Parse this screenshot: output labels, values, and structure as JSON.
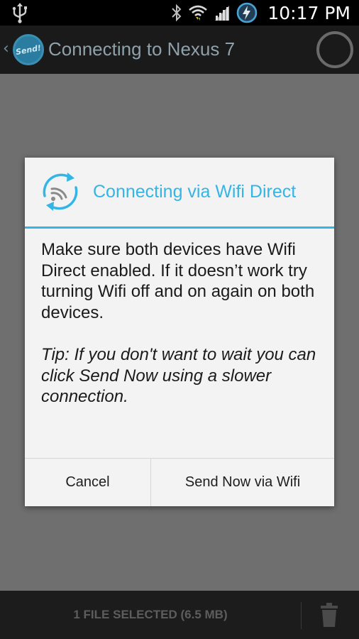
{
  "status_bar": {
    "time": "10:17 PM",
    "icons": [
      "usb-icon",
      "bluetooth-icon",
      "wifi-icon",
      "signal-icon",
      "battery-charging-icon"
    ]
  },
  "action_bar": {
    "title": "Connecting to Nexus 7",
    "logo_text": "Send!",
    "icons": [
      "app-logo-icon",
      "spinner-icon"
    ]
  },
  "dialog": {
    "title": "Connecting via Wifi Direct",
    "icon": "wifi-direct-sync-icon",
    "message": "Make sure both devices have Wifi Direct enabled. If it doesn’t work try turning Wifi off and on again on both devices.",
    "tip": "Tip: If you don't want to wait you can click Send Now using a slower connection.",
    "buttons": {
      "cancel": "Cancel",
      "send_now": "Send Now via Wifi"
    }
  },
  "bottom_bar": {
    "selection_label": "1 FILE SELECTED (6.5 MB)",
    "icons": [
      "trash-icon"
    ]
  },
  "colors": {
    "accent": "#33b5e5",
    "dialog_background": "#f3f3f3",
    "overlay_background": "#6f6f6f"
  }
}
